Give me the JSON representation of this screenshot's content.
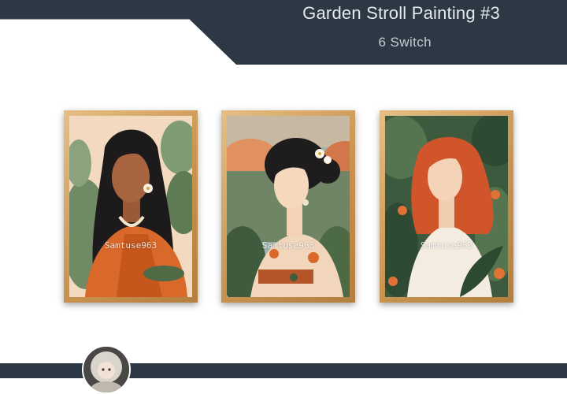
{
  "header": {
    "title": "Garden Stroll Painting #3",
    "subtitle": "6 Switch"
  },
  "paintings": [
    {
      "watermark": "Samtuse963"
    },
    {
      "watermark": "Samtuse963"
    },
    {
      "watermark": "Samtuse963"
    }
  ],
  "colors": {
    "header_bg": "#2c3844",
    "frame_wood": "#d4a35f",
    "accent_orange": "#d9692b"
  },
  "icons": {
    "avatar": "creator-avatar-image"
  }
}
